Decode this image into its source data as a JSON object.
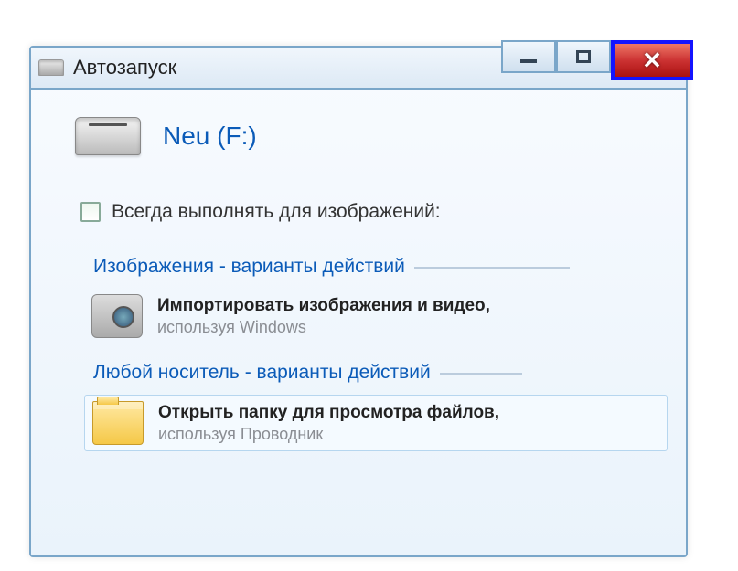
{
  "window": {
    "title": "Автозапуск"
  },
  "drive": {
    "label": "Neu (F:)"
  },
  "checkbox": {
    "label": "Всегда выполнять для изображений:"
  },
  "sections": [
    {
      "heading": "Изображения - варианты действий",
      "actions": [
        {
          "title": "Импортировать изображения и видео,",
          "sub": "используя Windows"
        }
      ]
    },
    {
      "heading": "Любой носитель - варианты действий",
      "actions": [
        {
          "title": "Открыть папку для просмотра файлов,",
          "sub": "используя Проводник"
        }
      ]
    }
  ]
}
